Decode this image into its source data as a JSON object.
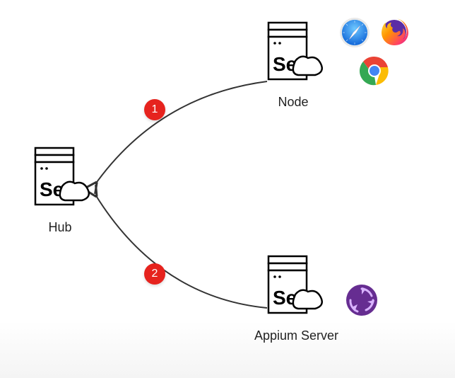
{
  "hub": {
    "label": "Hub"
  },
  "node": {
    "label": "Node"
  },
  "appium": {
    "label": "Appium Server"
  },
  "badges": {
    "one": "1",
    "two": "2"
  },
  "se_text": "Se",
  "icons": {
    "safari": "safari-icon",
    "firefox": "firefox-icon",
    "chrome": "chrome-icon",
    "appium": "appium-icon"
  }
}
